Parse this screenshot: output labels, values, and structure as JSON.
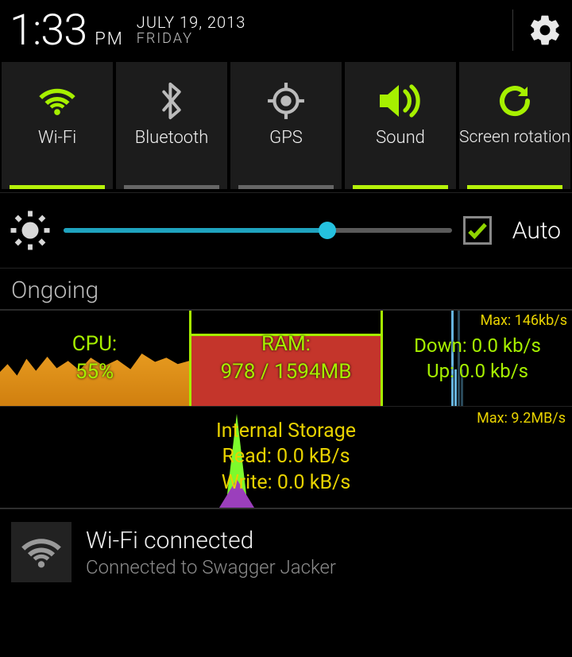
{
  "header": {
    "time": "1:33",
    "ampm": "PM",
    "date": "JULY 19, 2013",
    "day": "FRIDAY"
  },
  "toggles": [
    {
      "label": "Wi-Fi",
      "on": true
    },
    {
      "label": "Bluetooth",
      "on": false
    },
    {
      "label": "GPS",
      "on": false
    },
    {
      "label": "Sound",
      "on": true
    },
    {
      "label": "Screen rotation",
      "on": true
    }
  ],
  "brightness": {
    "auto_label": "Auto"
  },
  "section_heading": "Ongoing",
  "stats": {
    "cpu_label": "CPU:",
    "cpu_value": "55%",
    "ram_label": "RAM:",
    "ram_value": "978 / 1594MB",
    "net_max": "Max: 146kb/s",
    "net_down": "Down: 0.0 kb/s",
    "net_up": "Up: 0.0 kb/s",
    "storage_title": "Internal Storage",
    "storage_read": "Read: 0.0 kB/s",
    "storage_write": "Write: 0.0 kB/s",
    "storage_max": "Max: 9.2MB/s"
  },
  "wifi_notification": {
    "title": "Wi-Fi connected",
    "subtitle": "Connected to Swagger Jacker"
  },
  "chart_data": [
    {
      "type": "area",
      "title": "CPU",
      "values": [
        55
      ],
      "ylim": [
        0,
        100
      ],
      "ylabel": "%"
    },
    {
      "type": "bar",
      "title": "RAM",
      "values": [
        978
      ],
      "ylim": [
        0,
        1594
      ],
      "ylabel": "MB"
    },
    {
      "type": "line",
      "title": "Network",
      "series": [
        {
          "name": "Down",
          "values": [
            0.0
          ]
        },
        {
          "name": "Up",
          "values": [
            0.0
          ]
        }
      ],
      "ylim": [
        0,
        146
      ],
      "ylabel": "kb/s"
    },
    {
      "type": "line",
      "title": "Internal Storage",
      "series": [
        {
          "name": "Read",
          "values": [
            0.0
          ]
        },
        {
          "name": "Write",
          "values": [
            0.0
          ]
        }
      ],
      "ylim": [
        0,
        9.2
      ],
      "ylabel": "MB/s"
    }
  ]
}
